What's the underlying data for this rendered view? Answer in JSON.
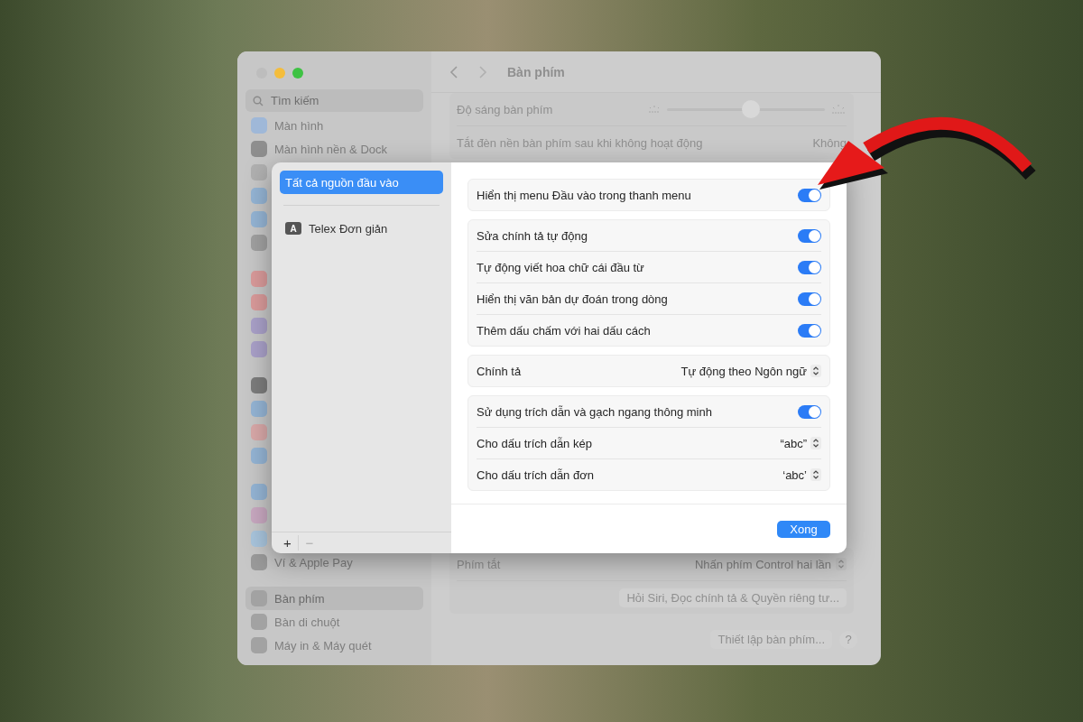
{
  "window": {
    "search": {
      "placeholder": "Tìm kiếm"
    },
    "sidebar": {
      "groups": [
        [
          {
            "label": "Màn hình",
            "color": "#9fb8d8",
            "selected": false
          },
          {
            "label": "Màn hình nền & Dock",
            "color": "#8e8e8e",
            "selected": false
          },
          {
            "color": "#b0b0b0"
          },
          {
            "color": "#94b4d4"
          },
          {
            "color": "#94b4d4"
          },
          {
            "color": "#a0a0a0"
          }
        ],
        [
          {
            "color": "#d99a9a"
          },
          {
            "color": "#d99a9a"
          },
          {
            "color": "#a9a0c8"
          },
          {
            "color": "#a9a0c8"
          }
        ],
        [
          {
            "color": "#7c7c7c"
          },
          {
            "color": "#94b4d4"
          },
          {
            "color": "#d8a8a8"
          },
          {
            "color": "#94b4d4"
          }
        ],
        [
          {
            "color": "#94b4d4"
          },
          {
            "color": "#c8a8c0"
          },
          {
            "color": "#a8c4dc"
          },
          {
            "label": "Ví & Apple Pay",
            "color": "#9a9a9a",
            "selected": false
          }
        ],
        [
          {
            "label": "Bàn phím",
            "color": "#a2a2a2",
            "selected": true
          },
          {
            "label": "Bàn di chuột",
            "color": "#a2a2a2",
            "selected": false
          },
          {
            "label": "Máy in & Máy quét",
            "color": "#a2a2a2",
            "selected": false
          }
        ]
      ]
    },
    "title": "Bàn phím",
    "settings_top": [
      {
        "kind": "slider",
        "label": "Độ sáng bàn phím",
        "level": 0.53
      },
      {
        "kind": "value",
        "label": "Tắt đèn nền bàn phím sau khi không hoạt động",
        "value": "Không"
      }
    ],
    "settings_bottom": [
      {
        "kind": "popup",
        "label": "Phím tắt",
        "value": "Nhấn phím Control hai lần"
      },
      {
        "kind": "button",
        "label": "Hỏi Siri, Đọc chính tả & Quyền riêng tư..."
      }
    ],
    "footer": {
      "setup_button": "Thiết lập bàn phím...",
      "help_button": "?"
    }
  },
  "dialog": {
    "sources": [
      {
        "kind": "all",
        "label": "Tất cả nguồn đầu vào",
        "selected": true
      },
      {
        "kind": "source",
        "badge": "A",
        "label": "Telex Đơn giản",
        "selected": false
      }
    ],
    "list_buttons": [
      "+",
      "−"
    ],
    "groups": [
      {
        "rows": [
          {
            "kind": "toggle",
            "label": "Hiển thị menu Đầu vào trong thanh menu",
            "on": true
          }
        ]
      },
      {
        "rows": [
          {
            "kind": "toggle",
            "label": "Sửa chính tả tự động",
            "on": true
          },
          {
            "kind": "toggle",
            "label": "Tự động viết hoa chữ cái đầu từ",
            "on": true
          },
          {
            "kind": "toggle",
            "label": "Hiển thị văn bản dự đoán trong dòng",
            "on": true
          },
          {
            "kind": "toggle",
            "label": "Thêm dấu chấm với hai dấu cách",
            "on": true
          }
        ]
      },
      {
        "rows": [
          {
            "kind": "popup",
            "label": "Chính tả",
            "value": "Tự động theo Ngôn ngữ"
          }
        ]
      },
      {
        "rows": [
          {
            "kind": "toggle",
            "label": "Sử dụng trích dẫn và gạch ngang thông minh",
            "on": true
          },
          {
            "kind": "popup",
            "label": "Cho dấu trích dẫn kép",
            "value": "“abc”"
          },
          {
            "kind": "popup",
            "label": "Cho dấu trích dẫn đơn",
            "value": "‘abc’"
          }
        ]
      }
    ],
    "done_button": "Xong"
  }
}
